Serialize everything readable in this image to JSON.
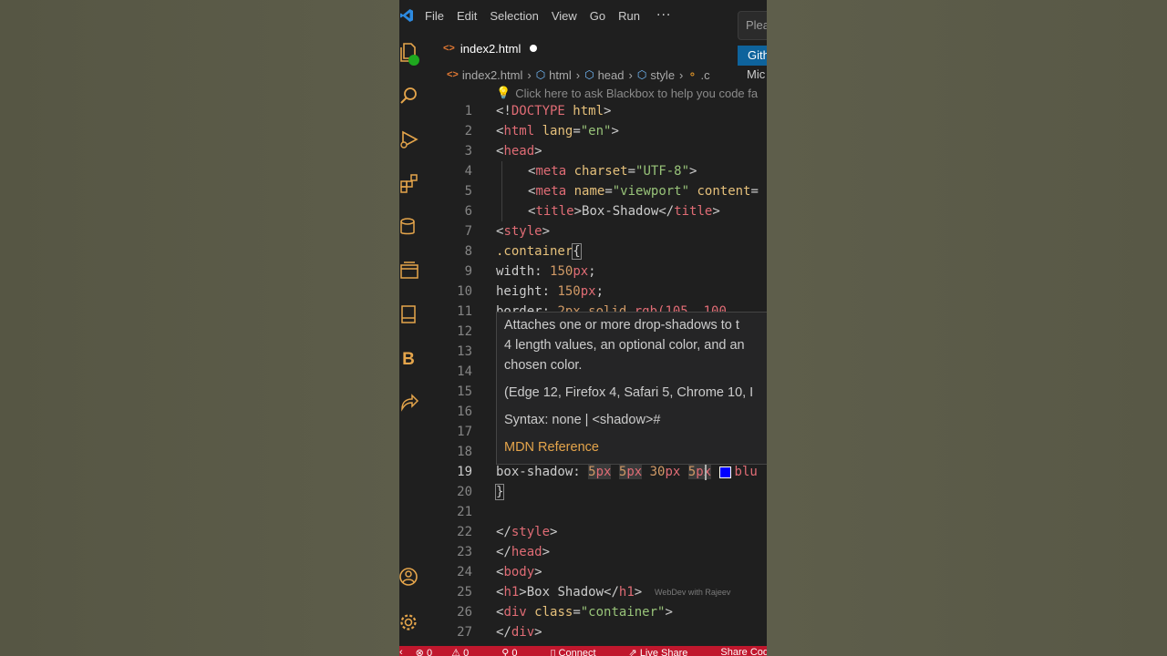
{
  "menu": {
    "items": [
      "File",
      "Edit",
      "Selection",
      "View",
      "Go",
      "Run"
    ],
    "more": "···"
  },
  "topright": {
    "search_placeholder": "Plea",
    "github_label": "Gith",
    "mic_label": "Mic"
  },
  "activity": {
    "icons": [
      "explorer-icon",
      "search-icon",
      "run-debug-icon",
      "extensions-icon",
      "database-icon",
      "remote-explorer-icon",
      "book-icon",
      "blackbox-icon",
      "live-share-icon",
      "account-icon",
      "settings-icon"
    ],
    "blackbox_letter": "B"
  },
  "tab": {
    "title": "index2.html",
    "icon": "<>"
  },
  "breadcrumb": {
    "items": [
      "index2.html",
      "html",
      "head",
      "style",
      ".c"
    ]
  },
  "hint": "Click here to ask Blackbox to help you code fa",
  "code": [
    {
      "n": "1"
    },
    {
      "n": "2"
    },
    {
      "n": "3"
    },
    {
      "n": "4"
    },
    {
      "n": "5"
    },
    {
      "n": "6"
    },
    {
      "n": "7"
    },
    {
      "n": "8"
    },
    {
      "n": "9"
    },
    {
      "n": "10"
    },
    {
      "n": "11"
    },
    {
      "n": "12"
    },
    {
      "n": "13"
    },
    {
      "n": "14"
    },
    {
      "n": "15"
    },
    {
      "n": "16"
    },
    {
      "n": "17"
    },
    {
      "n": "18"
    },
    {
      "n": "19"
    },
    {
      "n": "20"
    },
    {
      "n": "21"
    },
    {
      "n": "22"
    },
    {
      "n": "23"
    },
    {
      "n": "24"
    },
    {
      "n": "25"
    },
    {
      "n": "26"
    },
    {
      "n": "27"
    }
  ],
  "tokens": {
    "l1a": "<!",
    "l1b": "DOCTYPE",
    "l1c": " html",
    "l1d": ">",
    "l2a": "<",
    "l2b": "html",
    "l2c": " lang",
    "l2d": "=",
    "l2e": "\"en\"",
    "l2f": ">",
    "l3a": "<",
    "l3b": "head",
    "l3c": ">",
    "l4a": "<",
    "l4b": "meta",
    "l4c": " charset",
    "l4d": "=",
    "l4e": "\"UTF-8\"",
    "l4f": ">",
    "l5a": "<",
    "l5b": "meta",
    "l5c": " name",
    "l5d": "=",
    "l5e": "\"viewport\"",
    "l5f": " content",
    "l5g": "=",
    "l6a": "<",
    "l6b": "title",
    "l6c": ">",
    "l6d": "Box-Shadow",
    "l6e": "</",
    "l6f": "title",
    "l6g": ">",
    "l7a": "<",
    "l7b": "style",
    "l7c": ">",
    "l8a": ".container",
    "l8b": "{",
    "l9a": "width",
    "l9b": ": ",
    "l9c": "150",
    "l9d": "px",
    "l9e": ";",
    "l10a": "height",
    "l10b": ": ",
    "l10c": "150",
    "l10d": "px",
    "l10e": ";",
    "l11a": "border",
    "l11b": ": ",
    "l11c": "2px solid ",
    "l11d": "rgb(105, 100",
    "l19a": "box-shadow",
    "l19b": ": ",
    "l19c": "5",
    "l19d": "px",
    "l19e": "5",
    "l19f": "px",
    "l19g": "30",
    "l19h": "px",
    "l19i": "5",
    "l19j": "px",
    "l19k": "blu",
    "l20a": "}",
    "l22a": "</",
    "l22b": "style",
    "l22c": ">",
    "l23a": "</",
    "l23b": "head",
    "l23c": ">",
    "l24a": "<",
    "l24b": "body",
    "l24c": ">",
    "l25a": "<",
    "l25b": "h1",
    "l25c": ">",
    "l25d": "Box Shadow",
    "l25e": "</",
    "l25f": "h1",
    "l25g": ">",
    "l26a": "<",
    "l26b": "div",
    "l26c": " class",
    "l26d": "=",
    "l26e": "\"container\"",
    "l26f": ">",
    "l27a": "</",
    "l27b": "div",
    "l27c": ">"
  },
  "hover": {
    "line1": "Attaches one or more drop-shadows to t",
    "line2": "4 length values, an optional color, and an",
    "line3": "chosen color.",
    "compat": "(Edge 12, Firefox 4, Safari 5, Chrome 10, I",
    "syntax": "Syntax: none | <shadow>#",
    "mdn": "MDN Reference"
  },
  "watermark": "WebDev with Rajeev",
  "status": {
    "errors": "0",
    "warnings": "0",
    "ports": "0",
    "connect": "Connect",
    "live_share": "Live Share",
    "share_code": "Share Code Link"
  },
  "colors": {
    "editor_bg": "#1f1f1f",
    "status_bar": "#c0172d",
    "tag": "#e06c75",
    "string": "#98c379",
    "attribute": "#e5c07b",
    "number": "#d19a66"
  }
}
